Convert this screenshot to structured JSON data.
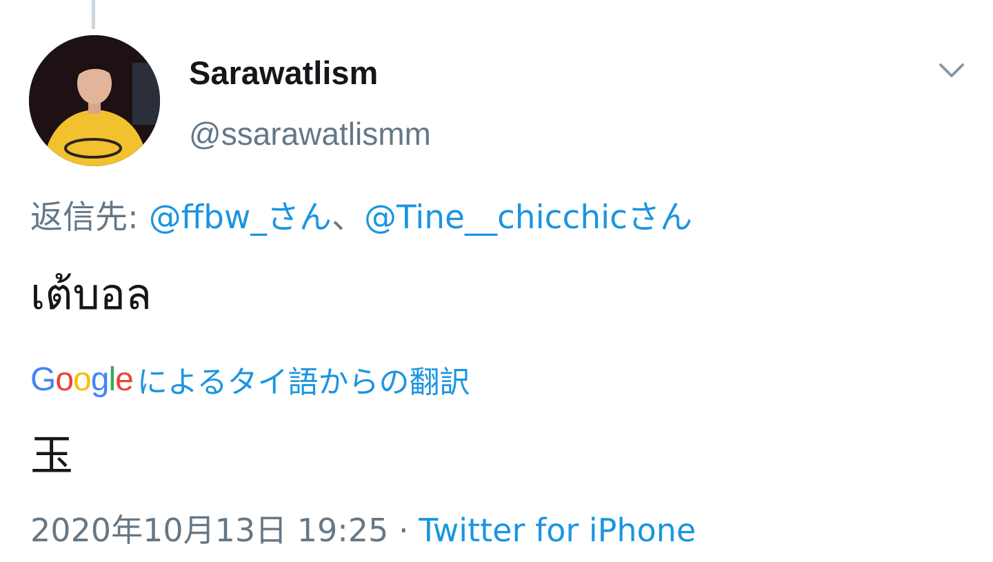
{
  "tweet": {
    "display_name": "Sarawatlism",
    "handle": "@ssarawatlismm",
    "reply_prefix": "返信先: ",
    "reply_users": [
      "@ffbw_さん",
      "@Tine__chicchicさん"
    ],
    "reply_separator": "、",
    "text": "เต้บอล",
    "translation": {
      "logo_text": "Google",
      "label": "によるタイ語からの翻訳",
      "text": "玉"
    },
    "timestamp": "2020年10月13日 19:25",
    "separator": " · ",
    "source": "Twitter for iPhone"
  },
  "colors": {
    "link": "#1b95e0",
    "secondary_text": "#657786",
    "primary_text": "#14171a",
    "thread_line": "#ccd6dd"
  },
  "icons": {
    "menu": "chevron-down-icon"
  }
}
